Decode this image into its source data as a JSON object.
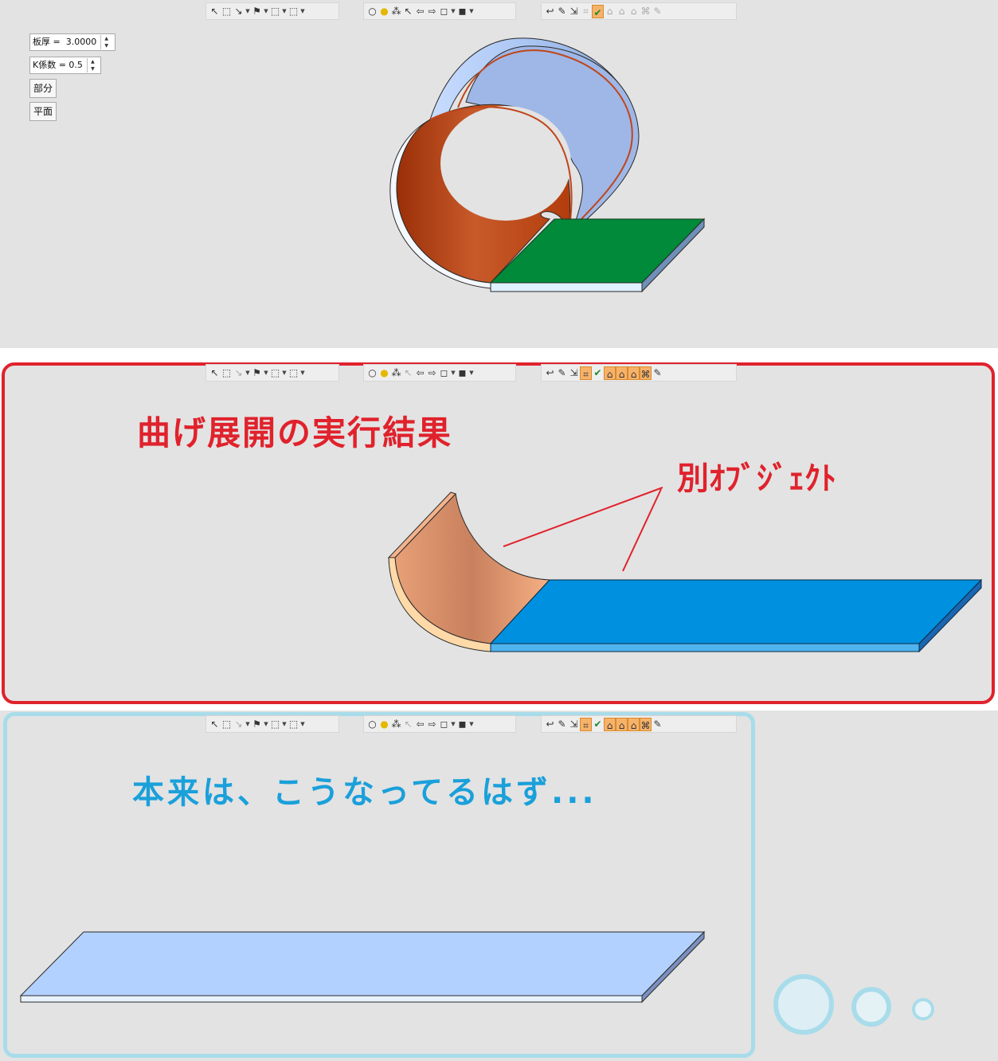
{
  "toolbar_sets": [
    {
      "groups": [
        [
          "↖",
          "⬚",
          "↘",
          "▾",
          "⚑",
          "▾",
          "⬚",
          "▾",
          "⬚",
          "▾"
        ],
        [
          "○",
          "●",
          "⁂",
          "↖",
          "⇦",
          "⇨",
          "◻",
          "▾",
          "◼",
          "▾"
        ],
        [
          "↩",
          "✎",
          "⇲",
          "⌗",
          "✔",
          "⌂",
          "⌂",
          "⌂",
          "⌘",
          "✎"
        ]
      ]
    }
  ],
  "params": {
    "thickness_label": "板厚 =  3.0000",
    "k_factor_label": "K係数 = 0.5",
    "partial_button": "部分",
    "flat_button": "平面"
  },
  "captions": {
    "result_title": "曲げ展開の実行結果",
    "separate_objects": "別ｵﾌﾞｼﾞｪｸﾄ",
    "expected": "本来は、こうなってるはず..."
  },
  "colors": {
    "red_frame": "#e0222c",
    "blue_frame": "#a8dcea",
    "bend_orange": "#c0451a",
    "flange_green": "#008a3a",
    "flat_blue": "#0090e0",
    "flat_lightblue": "#b3d1ff",
    "bend_peach": "#f2a57a"
  }
}
